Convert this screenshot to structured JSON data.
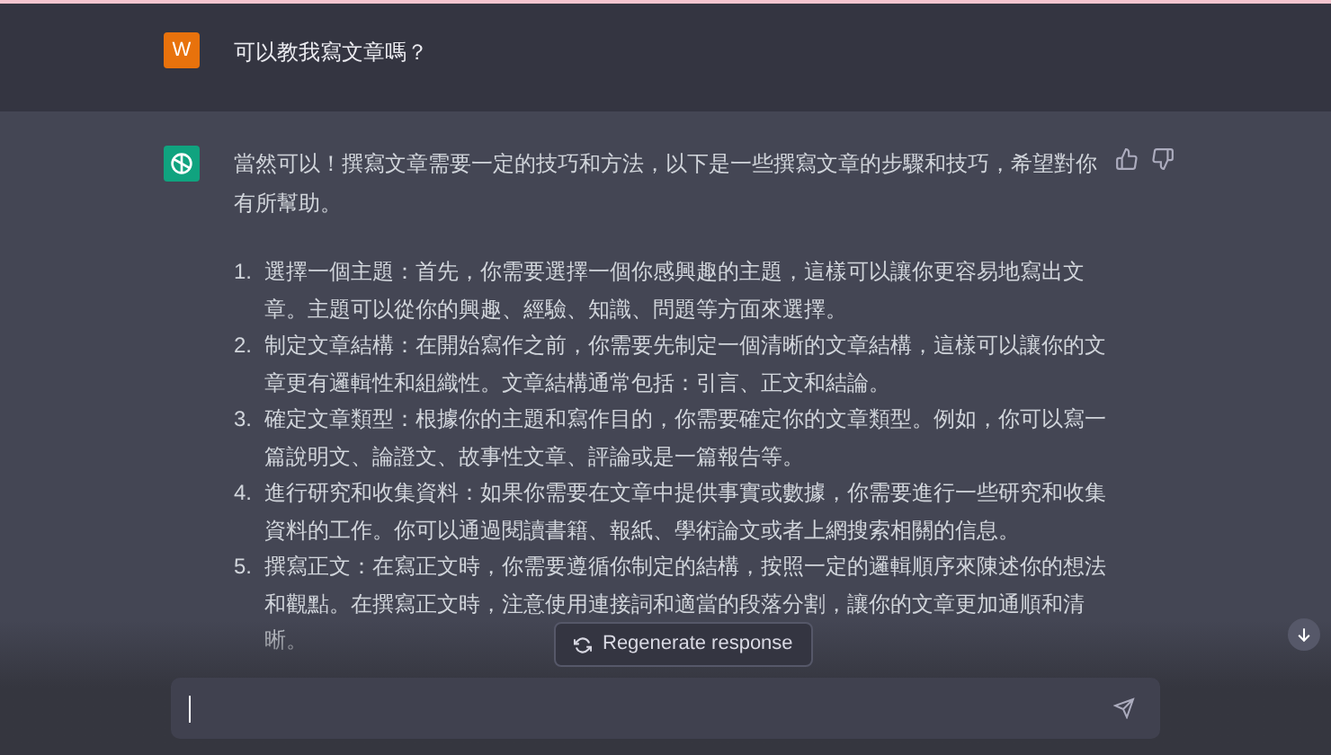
{
  "user_message": {
    "avatar_letter": "W",
    "text": "可以教我寫文章嗎？"
  },
  "assistant_message": {
    "intro": "當然可以！撰寫文章需要一定的技巧和方法，以下是一些撰寫文章的步驟和技巧，希望對你有所幫助。",
    "steps": [
      {
        "number": "1.",
        "lines": [
          "選擇一個主題：首先，你需要選擇一個你感興趣的主題，這樣可以讓你更容易地寫出文",
          "章。主題可以從你的興趣、經驗、知識、問題等方面來選擇。"
        ]
      },
      {
        "number": "2.",
        "lines": [
          "制定文章結構：在開始寫作之前，你需要先制定一個清晰的文章結構，這樣可以讓你的文",
          "章更有邏輯性和組織性。文章結構通常包括：引言、正文和結論。"
        ]
      },
      {
        "number": "3.",
        "lines": [
          "確定文章類型：根據你的主題和寫作目的，你需要確定你的文章類型。例如，你可以寫一",
          "篇說明文、論證文、故事性文章、評論或是一篇報告等。"
        ]
      },
      {
        "number": "4.",
        "lines": [
          "進行研究和收集資料：如果你需要在文章中提供事實或數據，你需要進行一些研究和收集",
          "資料的工作。你可以通過閱讀書籍、報紙、學術論文或者上網搜索相關的信息。"
        ]
      },
      {
        "number": "5.",
        "lines": [
          "撰寫正文：在寫正文時，你需要遵循你制定的結構，按照一定的邏輯順序來陳述你的想法",
          "和觀點。在撰寫正文時，注意使用連接詞和適當的段落分割，讓你的文章更加通順和清",
          "晰。"
        ]
      }
    ]
  },
  "regenerate_button": {
    "label": "Regenerate response"
  }
}
